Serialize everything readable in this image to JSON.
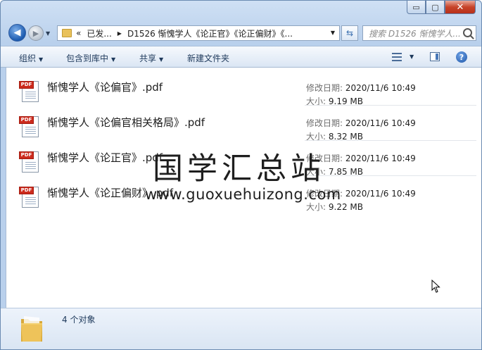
{
  "window": {
    "caption_buttons": {
      "minimize": "▭",
      "maximize": "▢",
      "close": "✕"
    }
  },
  "address": {
    "crumbs": [
      "«",
      "已发...",
      "D1526 惭愧学人《论正官》《论正偏财》《..."
    ],
    "search_placeholder": "搜索 D1526 惭愧学人..."
  },
  "toolbar": {
    "organize": "组织",
    "include_in_library": "包含到库中",
    "share": "共享",
    "new_folder": "新建文件夹"
  },
  "labels": {
    "modified": "修改日期:",
    "size": "大小:"
  },
  "files": [
    {
      "name": "惭愧学人《论偏官》.pdf",
      "modified": "2020/11/6 10:49",
      "size": "9.19 MB"
    },
    {
      "name": "惭愧学人《论偏官相关格局》.pdf",
      "modified": "2020/11/6 10:49",
      "size": "8.32 MB"
    },
    {
      "name": "惭愧学人《论正官》.pdf",
      "modified": "2020/11/6 10:49",
      "size": "7.85 MB"
    },
    {
      "name": "惭愧学人《论正偏财》.pdf",
      "modified": "2020/11/6 10:49",
      "size": "9.22 MB"
    }
  ],
  "icons": {
    "file_type": "pdf-icon",
    "file_tag": "PDF"
  },
  "watermark": {
    "cn": "国学汇总站",
    "en": "www.guoxuehuizong.com"
  },
  "status": {
    "item_count": "4 个对象"
  },
  "colors": {
    "accent": "#1e395b",
    "pdf_red": "#cc2b1d",
    "close_red": "#c7432a"
  }
}
